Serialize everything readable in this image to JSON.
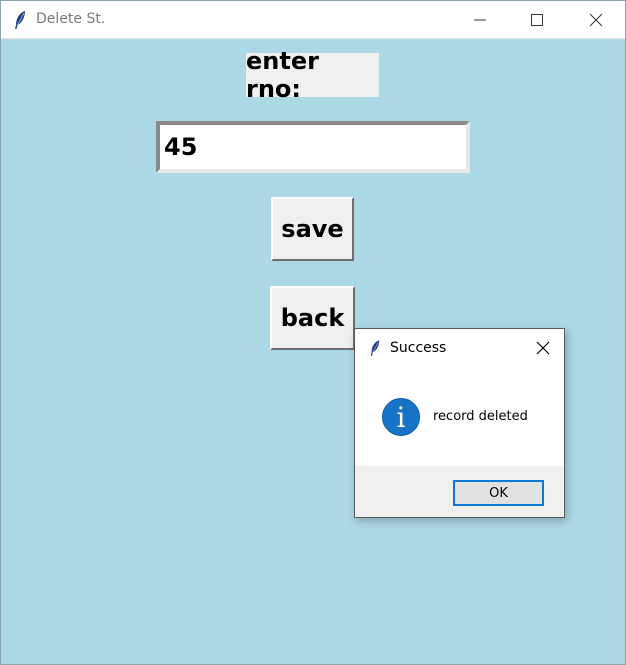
{
  "window": {
    "title": "Delete St."
  },
  "form": {
    "label": "enter rno:",
    "rno_value": "45",
    "save_label": "save",
    "back_label": "back"
  },
  "dialog": {
    "title": "Success",
    "message": "record deleted",
    "ok_label": "OK"
  },
  "icons": {
    "app": "feather-icon",
    "minimize": "minimize-icon",
    "maximize": "maximize-icon",
    "close": "close-icon",
    "info": "info-icon"
  },
  "colors": {
    "background": "#add8e6",
    "info_blue": "#1673c8",
    "ok_focus": "#0a78d6"
  }
}
